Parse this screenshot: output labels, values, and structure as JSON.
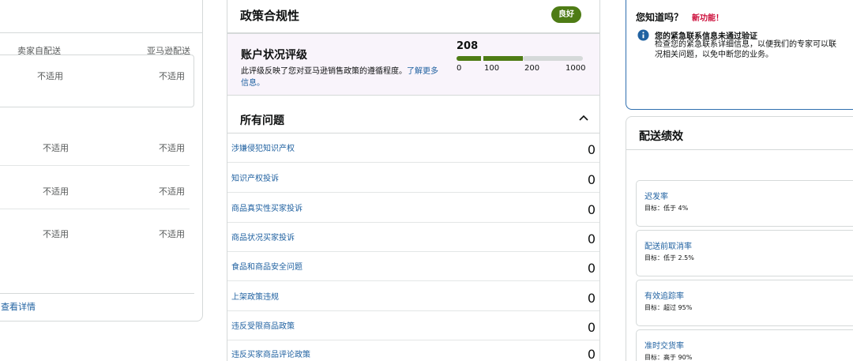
{
  "left": {
    "columns": [
      "卖家自配送",
      "亚马逊配送"
    ],
    "rows": [
      [
        "不适用",
        "不适用"
      ],
      [
        "不适用",
        "不适用"
      ],
      [
        "不适用",
        "不适用"
      ],
      [
        "不适用",
        "不适用"
      ]
    ],
    "footer_link": "查看详情"
  },
  "policy": {
    "title": "政策合规性",
    "badge": "良好",
    "rating_title": "账户状况评级",
    "rating_desc": "此评级反映了您对亚马逊销售政策的遵循程度。",
    "rating_link": "了解更多信息。",
    "score": "208",
    "ticks": [
      "0",
      "100",
      "200",
      "1000"
    ],
    "issues_title": "所有问题",
    "issues": [
      {
        "name": "涉嫌侵犯知识产权",
        "count": "0"
      },
      {
        "name": "知识产权投诉",
        "count": "0"
      },
      {
        "name": "商品真实性买家投诉",
        "count": "0"
      },
      {
        "name": "商品状况买家投诉",
        "count": "0"
      },
      {
        "name": "食品和商品安全问题",
        "count": "0"
      },
      {
        "name": "上架政策违规",
        "count": "0"
      },
      {
        "name": "违反受限商品政策",
        "count": "0"
      },
      {
        "name": "违反买家商品评论政策",
        "count": "0"
      }
    ]
  },
  "notice": {
    "heading": "您知道吗？",
    "new_feature": "新功能！",
    "alert_title": "您的紧急联系信息未通过验证",
    "alert_body_1": "检查您的紧急联系详细信息，以便我们的专家可以联",
    "alert_body_2": "况相关问题，以免中断您的业务。"
  },
  "shipping": {
    "title": "配送绩效",
    "metrics": [
      {
        "name": "迟发率",
        "target": "目标：低于 4%"
      },
      {
        "name": "配送前取消率",
        "target": "目标：低于 2.5%"
      },
      {
        "name": "有效追踪率",
        "target": "目标：超过 95%"
      },
      {
        "name": "准时交货率",
        "target": "目标：高于 90%"
      }
    ]
  },
  "colors": {
    "accent_green": "#4e7c15",
    "link_blue": "#2162a1",
    "alert_red": "#cc0c39"
  }
}
